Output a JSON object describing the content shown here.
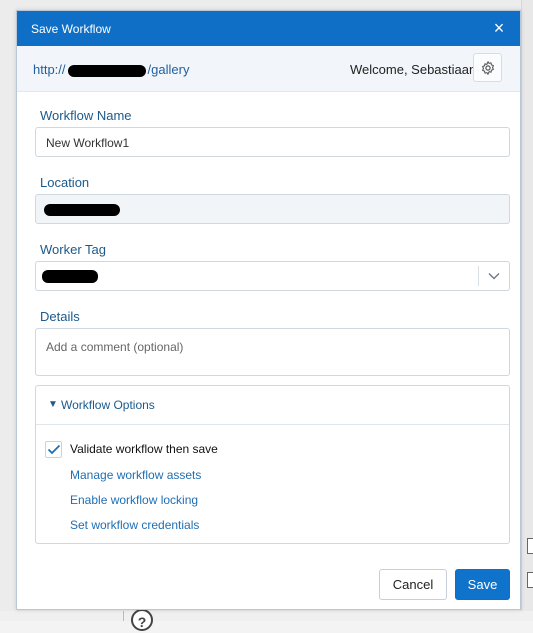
{
  "dialog": {
    "title": "Save Workflow",
    "close_label": "×"
  },
  "header": {
    "url_prefix": "http://",
    "url_suffix": "/gallery",
    "welcome": "Welcome, Sebastiaan"
  },
  "form": {
    "workflow_name": {
      "label": "Workflow Name",
      "value": "New Workflow1"
    },
    "location": {
      "label": "Location"
    },
    "worker_tag": {
      "label": "Worker Tag"
    },
    "details": {
      "label": "Details",
      "placeholder": "Add a comment (optional)"
    }
  },
  "options": {
    "toggle_icon": "▼",
    "title": "Workflow Options",
    "validate": {
      "label": "Validate workflow then save",
      "checked": true
    },
    "links": [
      "Manage workflow assets",
      "Enable workflow locking",
      "Set workflow credentials"
    ]
  },
  "buttons": {
    "cancel": "Cancel",
    "save": "Save"
  },
  "background": {
    "help_icon": "?"
  },
  "colors": {
    "titlebar": "#0f6fc6",
    "label": "#1b5a8c",
    "link": "#1f6fb2",
    "primary_button": "#0f73cc"
  }
}
